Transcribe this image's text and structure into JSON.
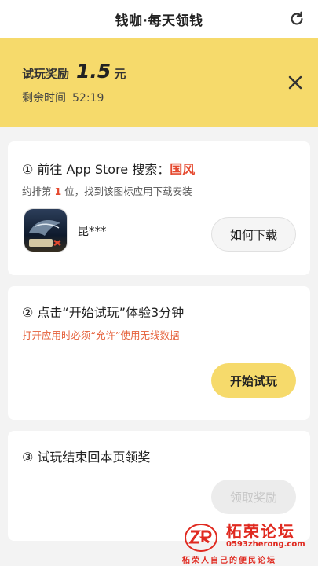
{
  "header": {
    "title": "钱咖·每天领钱",
    "refresh_icon": "refresh-icon"
  },
  "banner": {
    "reward_label": "试玩奖励",
    "reward_amount": "1.5",
    "reward_unit": "元",
    "time_label": "剩余时间",
    "time_value": "52:19",
    "close_icon": "close-icon",
    "background_color": "#f6da6b"
  },
  "step1": {
    "prefix": "① 前往 App Store 搜索：",
    "keyword": "国风",
    "rank_prefix": "约排第 ",
    "rank_number": "1",
    "rank_suffix": " 位，找到该图标应用下载安装",
    "app_name": "昆***",
    "how_to_button": "如何下载"
  },
  "step2": {
    "title": "② 点击“开始试玩”体验3分钟",
    "warning": "打开应用时必须“允许”使用无线数据",
    "start_button": "开始试玩"
  },
  "step3": {
    "title": "③ 试玩结束回本页领奖",
    "claim_button": "领取奖励"
  },
  "watermark": {
    "brand": "柘荣论坛",
    "domain": "0593zherong.com",
    "slogan": "柘荣人自己的便民论坛"
  },
  "colors": {
    "accent_yellow": "#f6da6b",
    "highlight_red": "#e5492f"
  }
}
